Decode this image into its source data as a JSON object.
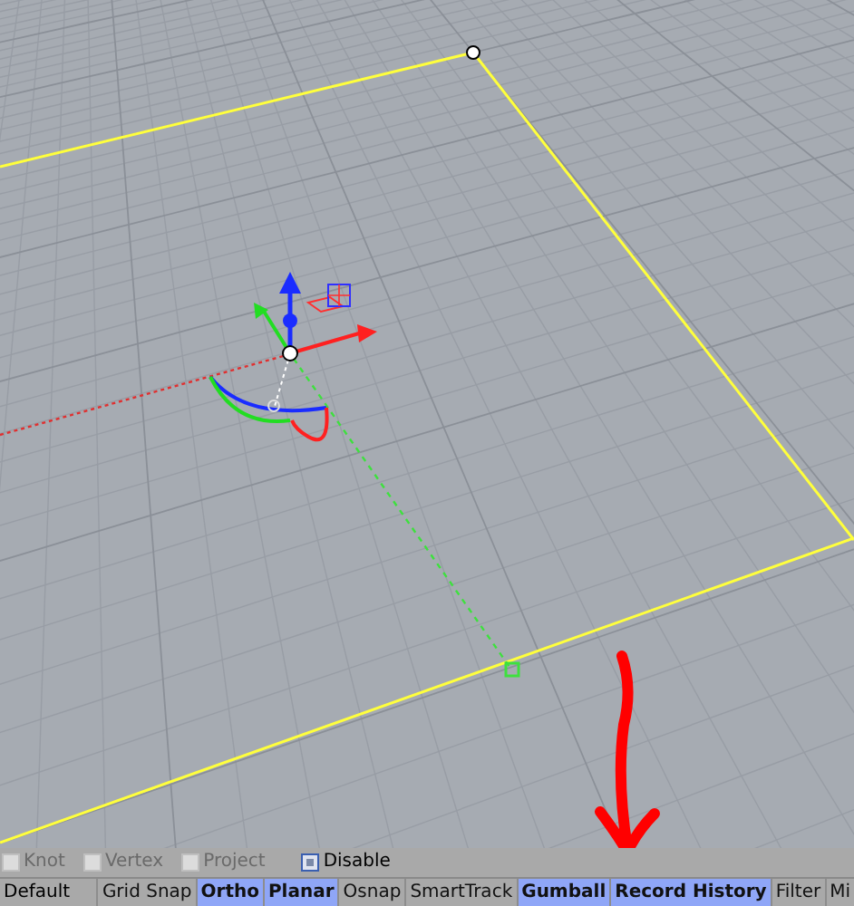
{
  "osnap": [
    {
      "label": "Knot",
      "checked": false,
      "disabled": true
    },
    {
      "label": "Vertex",
      "checked": false,
      "disabled": true
    },
    {
      "label": "Project",
      "checked": false,
      "disabled": true
    },
    {
      "label": "Disable",
      "checked": true,
      "disabled": false
    }
  ],
  "status_bar": {
    "layer": "Default",
    "panes": [
      {
        "label": "Grid Snap",
        "on": false
      },
      {
        "label": "Ortho",
        "on": true
      },
      {
        "label": "Planar",
        "on": true
      },
      {
        "label": "Osnap",
        "on": false
      },
      {
        "label": "SmartTrack",
        "on": false
      },
      {
        "label": "Gumball",
        "on": true
      },
      {
        "label": "Record History",
        "on": true
      },
      {
        "label": "Filter",
        "on": false
      },
      {
        "label": "Mi",
        "on": false
      }
    ]
  }
}
